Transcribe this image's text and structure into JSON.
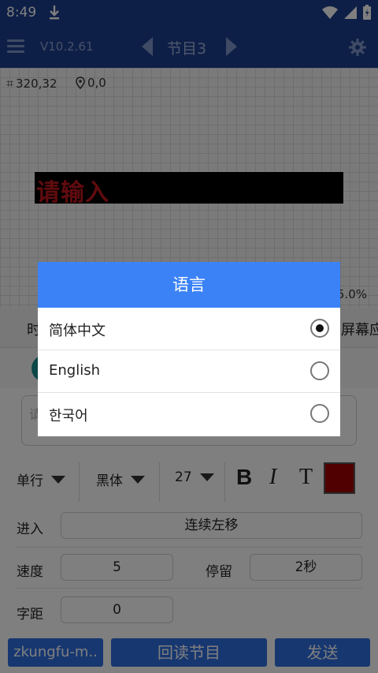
{
  "status_bar": {
    "time": "8:49"
  },
  "app_bar": {
    "version": "V10.2.61",
    "program_title": "节目3"
  },
  "canvas": {
    "size_readout": "320,32",
    "position_readout": "0,0",
    "led_text": "请输入",
    "zoom": "5.0%"
  },
  "panel": {
    "tab_left_partial": "时",
    "tab_right_partial": "屏幕应",
    "text_placeholder_partial": "请",
    "line_mode": "单行",
    "font_name": "黑体",
    "font_size": "27",
    "bold_label": "B",
    "italic_label": "I",
    "text_color_label": "T",
    "text_color": "#a00000",
    "enter_label": "进入",
    "enter_value": "连续左移",
    "speed_label": "速度",
    "speed_value": "5",
    "stay_label": "停留",
    "stay_value": "2秒",
    "spacing_label": "字距",
    "spacing_value": "0"
  },
  "bottom_buttons": {
    "device": "zkungfu-m..",
    "readback": "回读节目",
    "send": "发送"
  },
  "dialog": {
    "title": "语言",
    "options": [
      {
        "label": "简体中文",
        "selected": true
      },
      {
        "label": "English",
        "selected": false
      },
      {
        "label": "한국어",
        "selected": false
      }
    ]
  },
  "colors": {
    "bar": "#1c3f8f",
    "dialog_header": "#3b82f6",
    "button": "#2e6fe0"
  }
}
